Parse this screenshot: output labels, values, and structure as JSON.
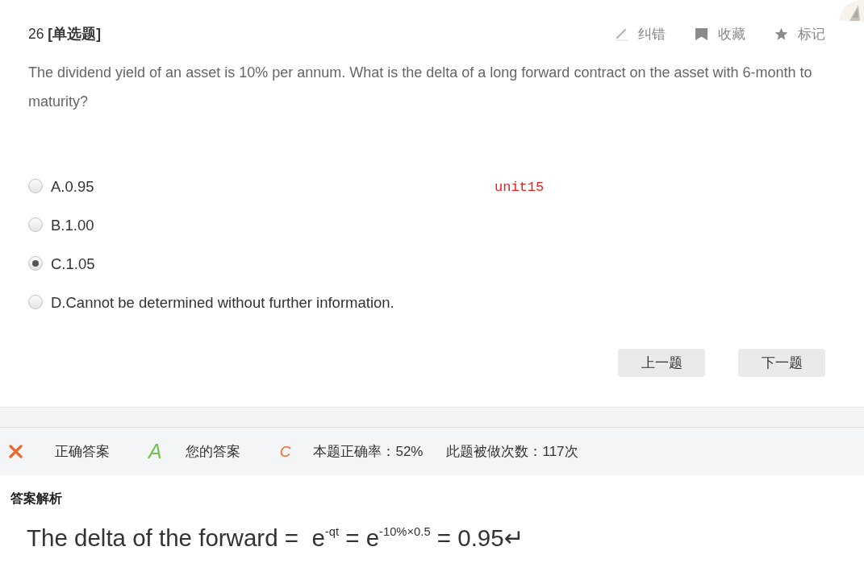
{
  "header": {
    "title": "26 **[单选题]**",
    "actions": [
      {
        "kind": "edit",
        "label": "纠错"
      },
      {
        "kind": "bookmark",
        "label": "收藏"
      },
      {
        "kind": "star",
        "label": "标记"
      }
    ]
  },
  "question": "The dividend yield of an asset is 10% per annum. What is the delta of a long forward contract on the asset with 6-month to maturity?",
  "options": [
    {
      "label": "A.0.95",
      "selected": false
    },
    {
      "label": "B.1.00",
      "selected": false
    },
    {
      "label": "C.1.05",
      "selected": true
    },
    {
      "label": "D.Cannot be determined without further information.",
      "selected": false
    }
  ],
  "unit_tag": "unit15",
  "nav_buttons": [
    {
      "label": "上一题"
    },
    {
      "label": "下一题"
    }
  ],
  "result": {
    "correct": false,
    "correct_answer_label": "正确答案",
    "correct_answer": "A",
    "your_answer_label": "您的答案",
    "your_answer": "C",
    "accuracy": "本题正确率：52%",
    "attempts": "此题被做次数：117次"
  },
  "explanation": {
    "title": "答案解析",
    "formula": "The delta of the forward =  e$^{-qt}$ = e$^{-10%×0.5}$ = 0.95↵"
  }
}
